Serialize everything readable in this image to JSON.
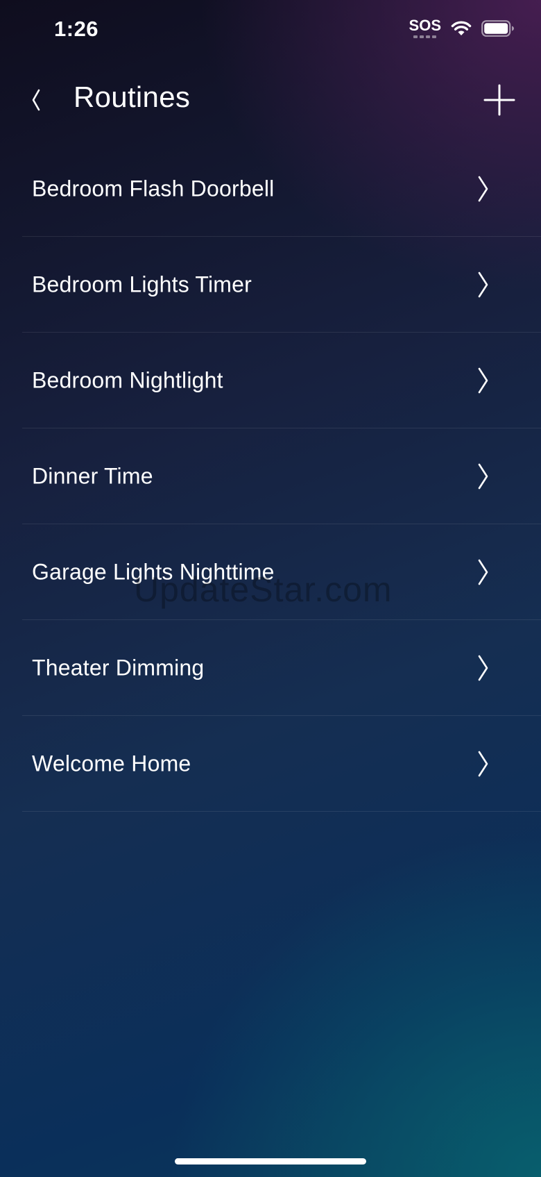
{
  "status_bar": {
    "time": "1:26",
    "sos": "SOS",
    "wifi_icon": "wifi-icon",
    "battery_icon": "battery-icon"
  },
  "header": {
    "title": "Routines",
    "back_icon": "chevron-left-icon",
    "add_icon": "plus-icon"
  },
  "routines": [
    {
      "label": "Bedroom Flash Doorbell"
    },
    {
      "label": "Bedroom Lights Timer"
    },
    {
      "label": "Bedroom Nightlight"
    },
    {
      "label": "Dinner Time"
    },
    {
      "label": "Garage Lights Nighttime"
    },
    {
      "label": "Theater Dimming"
    },
    {
      "label": "Welcome Home"
    }
  ],
  "watermark": "UpdateStar.com"
}
